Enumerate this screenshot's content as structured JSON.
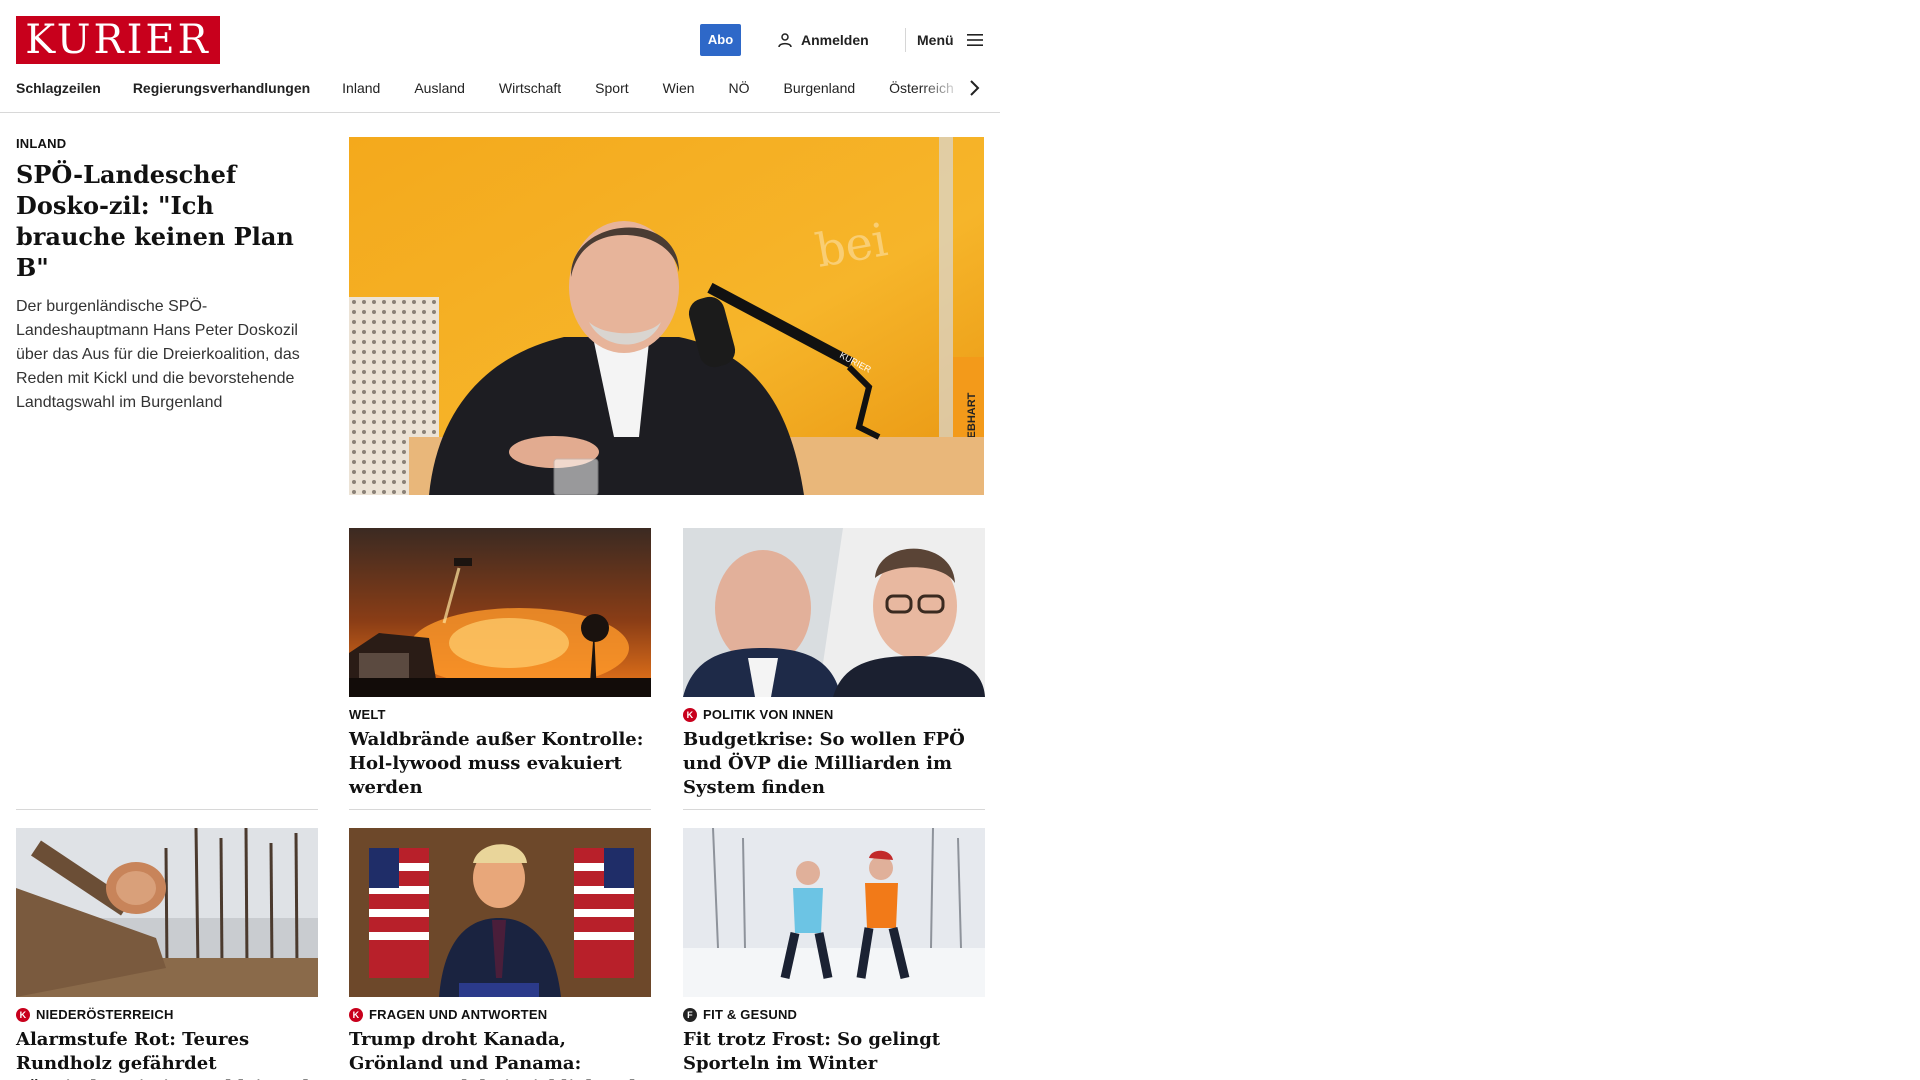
{
  "header": {
    "logo_text": "KURIER",
    "abo_label": "Abo",
    "login_label": "Anmelden",
    "menu_label": "Menü",
    "brand_color": "#c8001c",
    "abo_color": "#2e68c8"
  },
  "nav": {
    "items": [
      "Schlagzeilen",
      "Regierungsverhandlungen",
      "Inland",
      "Ausland",
      "Wirtschaft",
      "Sport",
      "Wien",
      "NÖ",
      "Burgenland",
      "Österreich"
    ]
  },
  "lead": {
    "kicker": "INLAND",
    "title": "SPÖ-Landeschef Dosko-zil: \"Ich brauche keinen Plan B\"",
    "teaser": "Der burgenländische SPÖ-Landeshauptmann Hans Peter Doskozil über das Aus für die Dreierkoalition, das Reden mit Kickl und die bevorstehende Landtagswahl im Burgenland",
    "image_text_mic": "KURIER",
    "image_text_side": "GEBHART",
    "image_text_bg": "bei"
  },
  "cards": [
    {
      "kicker": "WELT",
      "badge": "",
      "title": "Waldbrände außer Kontrolle: Hol-lywood muss evakuiert werden"
    },
    {
      "kicker": "POLITIK VON INNEN",
      "badge": "K",
      "title": "Budgetkrise: So wollen FPÖ und ÖVP die Milliarden im System finden"
    },
    {
      "kicker": "NIEDERÖSTERREICH",
      "badge": "K",
      "title": "Alarmstufe Rot: Teures Rundholz gefährdet Sägeindustrie im Waldviertel"
    },
    {
      "kicker": "FRAGEN UND ANTWORTEN",
      "badge": "K",
      "title": "Trump droht Kanada, Grönland und Panama: Worum es dabei wirklich geht"
    },
    {
      "kicker": "FIT & GESUND",
      "badge": "f",
      "title": "Fit trotz Frost: So gelingt Sporteln im Winter"
    }
  ]
}
